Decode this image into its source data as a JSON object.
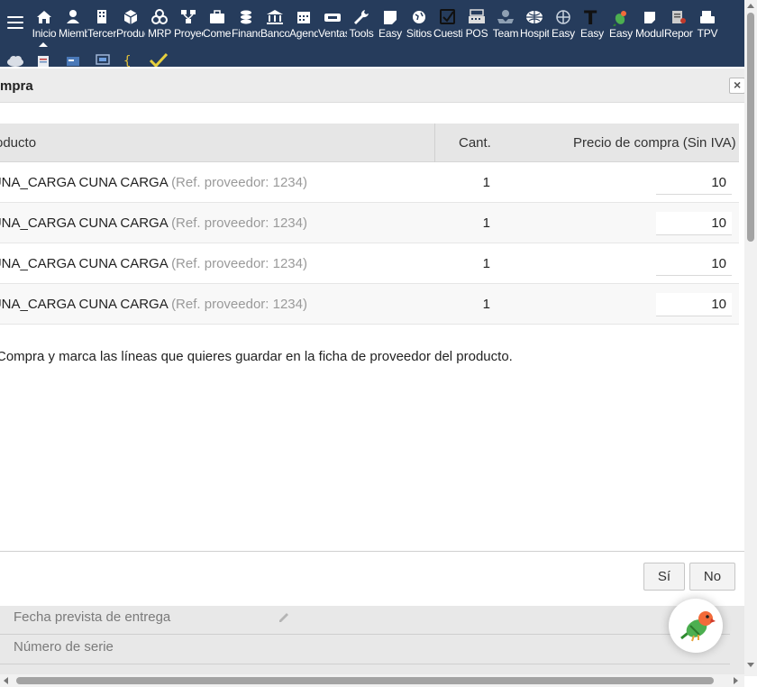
{
  "topbar": {
    "menu": [
      {
        "label": "Inicio",
        "icon": "home-icon",
        "active": true
      },
      {
        "label": "Miembros",
        "icon": "member-icon"
      },
      {
        "label": "Terceros",
        "icon": "building-icon"
      },
      {
        "label": "Productos",
        "icon": "cube-icon"
      },
      {
        "label": "MRP",
        "icon": "cubes-icon"
      },
      {
        "label": "Proyectos",
        "icon": "sitemap-icon"
      },
      {
        "label": "Comercial",
        "icon": "briefcase-icon"
      },
      {
        "label": "Financiera",
        "icon": "coins-icon"
      },
      {
        "label": "Bancos",
        "icon": "bank-icon"
      },
      {
        "label": "Agenda",
        "icon": "calendar-icon"
      },
      {
        "label": "Ventas",
        "icon": "ticket-icon"
      },
      {
        "label": "Tools",
        "icon": "wrench-icon"
      },
      {
        "label": "Easy",
        "icon": "note-icon"
      },
      {
        "label": "Sitios",
        "icon": "globe-icon"
      },
      {
        "label": "Cuestionario",
        "icon": "checkbox-icon"
      },
      {
        "label": "POS",
        "icon": "cash-register-icon"
      },
      {
        "label": "Team",
        "icon": "team-icon"
      },
      {
        "label": "Hospital",
        "icon": "hospital-icon"
      },
      {
        "label": "Easy",
        "icon": "easy-globe-icon"
      },
      {
        "label": "Easy",
        "icon": "text-icon"
      },
      {
        "label": "Easy",
        "icon": "parrot-icon"
      },
      {
        "label": "Modulos",
        "icon": "sticky-note-icon"
      },
      {
        "label": "Reportes",
        "icon": "report-icon"
      },
      {
        "label": "TPV",
        "icon": "tpv-icon"
      }
    ]
  },
  "dialog": {
    "title": "Compra",
    "close_symbol": "×",
    "columns": {
      "product": "Producto",
      "qty": "Cant.",
      "price": "Precio de compra (Sin IVA)"
    },
    "rows": [
      {
        "product": "CUNA_CARGA CUNA CARGA",
        "ref": "(Ref. proveedor: 1234)",
        "qty": "1",
        "price": "10"
      },
      {
        "product": "CUNA_CARGA CUNA CARGA",
        "ref": "(Ref. proveedor: 1234)",
        "qty": "1",
        "price": "10"
      },
      {
        "product": "CUNA_CARGA CUNA CARGA",
        "ref": "(Ref. proveedor: 1234)",
        "qty": "1",
        "price": "10"
      },
      {
        "product": "CUNA_CARGA CUNA CARGA",
        "ref": "(Ref. proveedor: 1234)",
        "qty": "1",
        "price": "10"
      }
    ],
    "instruction": "Compra y marca las líneas que quieres guardar en la ficha de proveedor del producto.",
    "buttons": {
      "yes": "Sí",
      "no": "No"
    }
  },
  "background_form": {
    "delivery_date_label": "Fecha prevista de entrega",
    "serial_label": "Número de serie"
  },
  "colors": {
    "topbar": "#263c5c",
    "header_bg": "#ececec",
    "table_header": "#e6e6e6"
  }
}
